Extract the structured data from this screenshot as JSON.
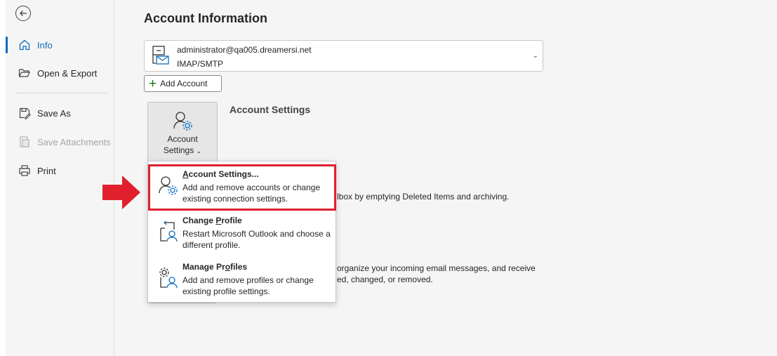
{
  "sidebar": {
    "items": [
      {
        "label": "Info",
        "icon": "home-icon",
        "state": "active"
      },
      {
        "label": "Open & Export",
        "icon": "folder-open-icon",
        "state": "normal"
      },
      {
        "label": "Save As",
        "icon": "save-as-icon",
        "state": "normal"
      },
      {
        "label": "Save Attachments",
        "icon": "save-attachments-icon",
        "state": "disabled"
      },
      {
        "label": "Print",
        "icon": "printer-icon",
        "state": "normal"
      }
    ]
  },
  "main": {
    "title": "Account Information",
    "account": {
      "email": "administrator@qa005.dreamersi.net",
      "type": "IMAP/SMTP"
    },
    "add_account_label": "Add Account",
    "account_settings_button": {
      "line1": "Account",
      "line2": "Settings"
    },
    "account_settings_heading": "Account Settings",
    "background_text": {
      "mailbox": "lbox by emptying Deleted Items and archiving.",
      "rules_1": "organize your incoming email messages, and receive",
      "rules_2": "ed, changed, or removed."
    }
  },
  "dropdown": {
    "items": [
      {
        "title_pre": "",
        "title_u": "A",
        "title_post": "ccount Settings...",
        "desc": "Add and remove accounts or change existing connection settings.",
        "icon": "account-settings-icon"
      },
      {
        "title_pre": "Change ",
        "title_u": "P",
        "title_post": "rofile",
        "desc": "Restart Microsoft Outlook and choose a different profile.",
        "icon": "change-profile-icon"
      },
      {
        "title_pre": "Manage Pr",
        "title_u": "o",
        "title_post": "files",
        "desc": "Add and remove profiles or change existing profile settings.",
        "icon": "manage-profiles-icon"
      }
    ]
  },
  "colors": {
    "accent": "#0f6cbd",
    "highlight": "#e0202c",
    "arrow": "#e0202c"
  }
}
